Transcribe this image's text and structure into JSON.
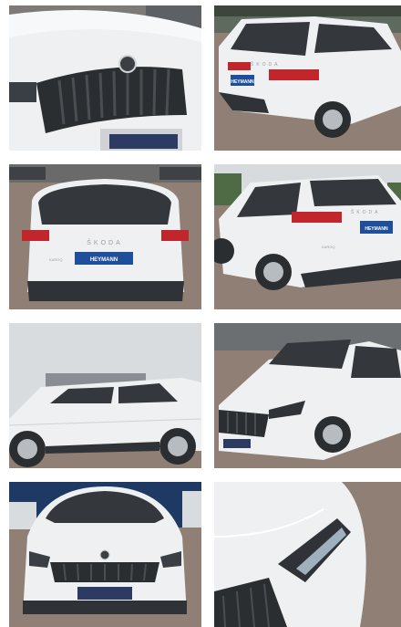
{
  "gallery": {
    "items": [
      {
        "view": "front-grille-closeup"
      },
      {
        "view": "rear-three-quarter-right",
        "brand": "ŠKODA",
        "plate": "HEYMANN"
      },
      {
        "view": "rear",
        "brand": "ŠKODA",
        "model": "KAROQ",
        "plate": "HEYMANN"
      },
      {
        "view": "rear-three-quarter-left",
        "brand": "ŠKODA",
        "model": "KAROQ",
        "plate": "HEYMANN"
      },
      {
        "view": "side-left"
      },
      {
        "view": "front-three-quarter-left"
      },
      {
        "view": "front"
      },
      {
        "view": "headlight-closeup"
      }
    ]
  },
  "colors": {
    "car_white": "#eef0f1",
    "pavement": "#8f7f74",
    "sky": "#d9dcde",
    "grille": "#2b2e31",
    "taillight": "#c0262b",
    "plate_blue": "#1f4f9a"
  }
}
